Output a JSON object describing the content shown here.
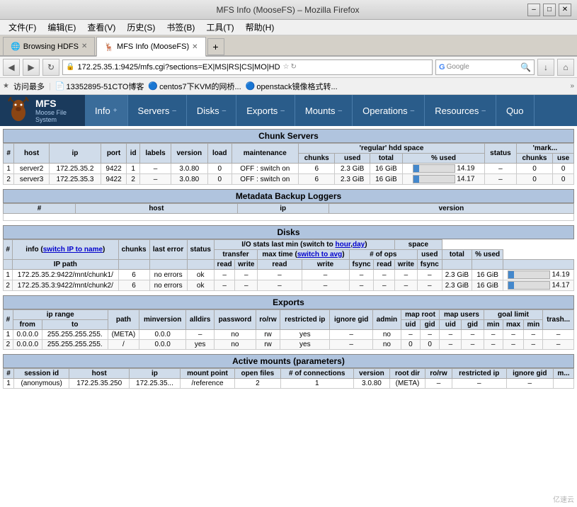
{
  "window": {
    "title": "MFS Info (MooseFS) – Mozilla Firefox",
    "min_label": "–",
    "max_label": "□",
    "close_label": "✕"
  },
  "menu": {
    "items": [
      "文件(F)",
      "编辑(E)",
      "查看(V)",
      "历史(S)",
      "书签(B)",
      "工具(T)",
      "帮助(H)"
    ]
  },
  "tabs": [
    {
      "label": "Browsing HDFS",
      "active": false,
      "icon": "🌐"
    },
    {
      "label": "MFS Info (MooseFS)",
      "active": true,
      "icon": "🦌"
    }
  ],
  "address": {
    "url": "172.25.35.1:9425/mfs.cgi?sections=EX|MS|RS|CS|MO|HD",
    "icon": "🔒"
  },
  "search": {
    "placeholder": "Google"
  },
  "bookmarks": [
    {
      "label": "访问最多",
      "icon": "★"
    },
    {
      "label": "13352895-51CTO博客",
      "icon": "📄"
    },
    {
      "label": "centos7下KVM的网桥...",
      "icon": "🔵"
    },
    {
      "label": "openstack镜像格式转...",
      "icon": "🔵"
    }
  ],
  "mfs_nav": {
    "logo_text": "MFS",
    "logo_sub": "Moose File System",
    "tabs": [
      {
        "label": "Info",
        "arrow": "+",
        "active": true
      },
      {
        "label": "Servers",
        "arrow": "–"
      },
      {
        "label": "Disks",
        "arrow": "–"
      },
      {
        "label": "Exports",
        "arrow": "–"
      },
      {
        "label": "Mounts",
        "arrow": "–"
      },
      {
        "label": "Operations",
        "arrow": "–"
      },
      {
        "label": "Resources",
        "arrow": "–"
      },
      {
        "label": "Quo",
        "arrow": ""
      }
    ]
  },
  "chunk_servers": {
    "section_title": "Chunk Servers",
    "sub_title": "'regular' hdd space",
    "cols": [
      "#",
      "host",
      "ip",
      "port",
      "id",
      "labels",
      "version",
      "load",
      "maintenance",
      "chunks",
      "used",
      "total",
      "% used",
      "status",
      "chunks",
      "use"
    ],
    "rows": [
      [
        "1",
        "server2",
        "172.25.35.2",
        "9422",
        "1",
        "–",
        "3.0.80",
        "0",
        "OFF : switch on",
        "6",
        "2.3 GiB",
        "16 GiB",
        "14.19",
        "–",
        "0",
        "0"
      ],
      [
        "2",
        "server3",
        "172.25.35.3",
        "9422",
        "2",
        "–",
        "3.0.80",
        "0",
        "OFF : switch on",
        "6",
        "2.3 GiB",
        "16 GiB",
        "14.17",
        "–",
        "0",
        "0"
      ]
    ],
    "progress": [
      14.19,
      14.17
    ]
  },
  "metadata_backup": {
    "section_title": "Metadata Backup Loggers",
    "cols": [
      "#",
      "host",
      "ip",
      "version"
    ],
    "rows": []
  },
  "disks": {
    "section_title": "Disks",
    "io_sub": "I/O stats last min (switch to hour,day)",
    "hour_link": "hour",
    "day_link": "day",
    "avg_link": "switch to avg",
    "info_link": "switch IP to name",
    "cols": [
      "#",
      "IP path",
      "chunks",
      "last error",
      "status",
      "read",
      "write",
      "read",
      "write",
      "fsync",
      "read",
      "write",
      "fsync",
      "used",
      "total",
      "% used"
    ],
    "rows": [
      [
        "1",
        "172.25.35.2:9422/mnt/chunk1/",
        "6",
        "no errors",
        "ok",
        "–",
        "–",
        "–",
        "–",
        "–",
        "–",
        "–",
        "–",
        "2.3 GiB",
        "16 GiB",
        "14.19"
      ],
      [
        "2",
        "172.25.35.3:9422/mnt/chunk2/",
        "6",
        "no errors",
        "ok",
        "–",
        "–",
        "–",
        "–",
        "–",
        "–",
        "–",
        "–",
        "2.3 GiB",
        "16 GiB",
        "14.17"
      ]
    ],
    "progress": [
      14.19,
      14.17
    ]
  },
  "exports": {
    "section_title": "Exports",
    "cols": [
      "#",
      "from",
      "to",
      "path",
      "minversion",
      "alldirs",
      "password",
      "ro/rw",
      "restricted ip",
      "ignore gid",
      "admin",
      "uid",
      "gid",
      "uid",
      "gid",
      "min",
      "max",
      "min"
    ],
    "rows": [
      [
        "1",
        "0.0.0.0",
        "255.255.255.255.",
        "(META)",
        "0.0.0",
        "–",
        "no",
        "rw",
        "yes",
        "–",
        "no",
        "–",
        "–",
        "–",
        "–",
        "–",
        "–",
        "–"
      ],
      [
        "2",
        "0.0.0.0",
        "255.255.255.255.",
        "/",
        "0.0.0",
        "yes",
        "no",
        "rw",
        "yes",
        "–",
        "no",
        "0",
        "0",
        "–",
        "–",
        "–",
        "–",
        "–"
      ]
    ]
  },
  "mounts": {
    "section_title": "Active mounts (parameters)",
    "cols": [
      "#",
      "session id",
      "host",
      "ip",
      "mount point",
      "open files",
      "# of connections",
      "version",
      "root dir",
      "ro/rw",
      "restricted ip",
      "ignore gid"
    ],
    "rows": [
      [
        "1",
        "(anonymous)",
        "172.25.35.250",
        "172.25.35...",
        "/reference",
        "2",
        "1",
        "3.0.80",
        "(META)",
        "–",
        "–",
        "–"
      ]
    ]
  }
}
